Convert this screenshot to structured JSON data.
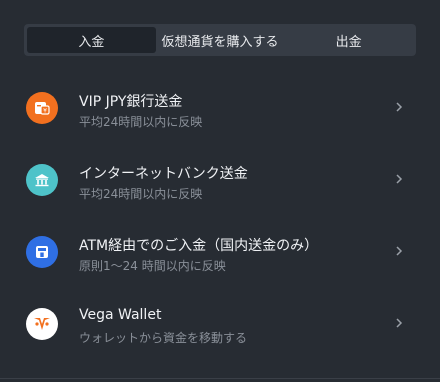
{
  "tabs": [
    {
      "label": "入金",
      "active": true
    },
    {
      "label": "仮想通貨を購入する",
      "active": false
    },
    {
      "label": "出金",
      "active": false
    }
  ],
  "methods": [
    {
      "title": "VIP JPY銀行送金",
      "subtitle": "平均24時間以内に反映",
      "icon": "bank-transfer-icon",
      "color": "#f2701f"
    },
    {
      "title": "インターネットバンク送金",
      "subtitle": "平均24時間以内に反映",
      "icon": "bank-building-icon",
      "color": "#4ec3c9"
    },
    {
      "title": "ATM経由でのご入金（国内送金のみ）",
      "subtitle": "原則1〜24 時間以内に反映",
      "icon": "atm-icon",
      "color": "#2f6fe4"
    },
    {
      "title": "Vega Wallet",
      "subtitle": "ウォレットから資金を移動する",
      "icon": "vega-wallet-icon",
      "color": "#ffffff"
    }
  ],
  "colors": {
    "background": "#272c33",
    "tab_bar": "#363c45",
    "tab_active": "#1f242b",
    "subtext": "#8a9099",
    "vega_orange": "#f2701f"
  }
}
